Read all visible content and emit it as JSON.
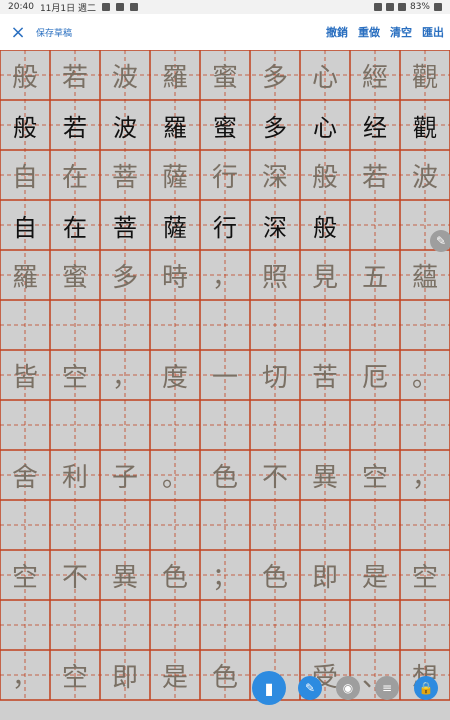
{
  "status_bar": {
    "time": "20:40",
    "date": "11月1日 週二",
    "battery": "83%"
  },
  "toolbar": {
    "close_icon": "×",
    "save_draft": "保存草稿",
    "undo": "撤銷",
    "redo": "重做",
    "clear": "清空",
    "export": "匯出"
  },
  "colors": {
    "accent": "#2a6fc0",
    "grid_line": "#c0401f",
    "grid_bg": "#cfcfcf"
  },
  "rows": [
    {
      "type": "model",
      "chars": [
        "般",
        "若",
        "波",
        "羅",
        "蜜",
        "多",
        "心",
        "經",
        "觀"
      ]
    },
    {
      "type": "hand",
      "chars": [
        "般",
        "若",
        "波",
        "羅",
        "蜜",
        "多",
        "心",
        "经",
        "觀"
      ]
    },
    {
      "type": "model",
      "chars": [
        "自",
        "在",
        "菩",
        "薩",
        "行",
        "深",
        "般",
        "若",
        "波"
      ]
    },
    {
      "type": "hand",
      "chars": [
        "自",
        "在",
        "菩",
        "薩",
        "行",
        "深",
        "般",
        "",
        ""
      ]
    },
    {
      "type": "model",
      "chars": [
        "羅",
        "蜜",
        "多",
        "時",
        "，",
        "照",
        "見",
        "五",
        "蘊"
      ]
    },
    {
      "type": "blank",
      "chars": [
        "",
        "",
        "",
        "",
        "",
        "",
        "",
        "",
        ""
      ]
    },
    {
      "type": "model",
      "chars": [
        "皆",
        "空",
        "，",
        "度",
        "一",
        "切",
        "苦",
        "厄",
        "。"
      ]
    },
    {
      "type": "blank",
      "chars": [
        "",
        "",
        "",
        "",
        "",
        "",
        "",
        "",
        ""
      ]
    },
    {
      "type": "model",
      "chars": [
        "舍",
        "利",
        "子",
        "。",
        "色",
        "不",
        "異",
        "空",
        "，"
      ]
    },
    {
      "type": "blank",
      "chars": [
        "",
        "",
        "",
        "",
        "",
        "",
        "",
        "",
        ""
      ]
    },
    {
      "type": "model",
      "chars": [
        "空",
        "不",
        "異",
        "色",
        "；",
        "色",
        "即",
        "是",
        "空"
      ]
    },
    {
      "type": "blank",
      "chars": [
        "",
        "",
        "",
        "",
        "",
        "",
        "",
        "",
        ""
      ]
    },
    {
      "type": "model",
      "chars": [
        "，",
        "空",
        "即",
        "是",
        "色",
        "",
        "受",
        "、",
        "想"
      ]
    }
  ]
}
